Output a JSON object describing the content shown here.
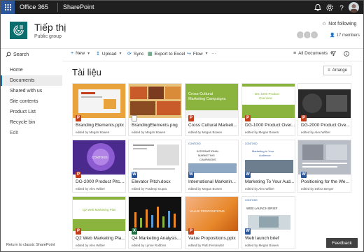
{
  "suite": {
    "brand": "Office 365",
    "app": "SharePoint",
    "icons": [
      "bell-icon",
      "gear-icon",
      "help-icon"
    ]
  },
  "site": {
    "title": "Tiếp thị",
    "subtitle": "Public group",
    "follow_label": "Not following",
    "members_label": "17 members"
  },
  "nav": {
    "search_label": "Search",
    "items": [
      {
        "label": "Home",
        "active": false
      },
      {
        "label": "Documents",
        "active": true
      },
      {
        "label": "Shared with us",
        "active": false
      },
      {
        "label": "Site contents",
        "active": false
      },
      {
        "label": "Product List",
        "active": false
      },
      {
        "label": "Recycle bin",
        "active": false
      },
      {
        "label": "Edit",
        "active": false
      }
    ],
    "return_label": "Return to classic SharePoint"
  },
  "commands": {
    "new": "New",
    "upload": "Upload",
    "sync": "Sync",
    "export": "Export to Excel",
    "flow": "Flow",
    "more": "···",
    "view": "All Documents"
  },
  "library": {
    "title": "Tài liệu",
    "arrange_label": "Arrange"
  },
  "tiles": [
    {
      "name": "Branding Elements.pptx",
      "edited": "edited by Megan Bowen",
      "type": "pptx",
      "thumb": "Brand",
      "colors": [
        "#e8a33c",
        "#ffffff"
      ]
    },
    {
      "name": "BrandingElements.png",
      "edited": "edited by Megan Bowen",
      "type": "png",
      "thumb": "",
      "colors": [
        "#c95b2a",
        "#e7c27a"
      ]
    },
    {
      "name": "Cross Cultural Marketi...",
      "edited": "edited by Megan Bowen",
      "type": "pptx",
      "thumb": "Cross-Cultural Marketing Campaigns",
      "colors": [
        "#8bb43e",
        "#ffffff"
      ]
    },
    {
      "name": "DG-1000 Product Over...",
      "edited": "edited by Megan Bowen",
      "type": "pptx",
      "thumb": "DG-1000 Product Overview",
      "colors": [
        "#ffffff",
        "#8bb43e"
      ]
    },
    {
      "name": "DG-2000 Product Ove...",
      "edited": "edited by Alex Wilber",
      "type": "pptx",
      "thumb": "",
      "colors": [
        "#2a2a2a",
        "#444444"
      ]
    },
    {
      "name": "DG-2000 Product Pitch...",
      "edited": "edited by Alex Wilber",
      "type": "pptx",
      "thumb": "CONTOSO",
      "colors": [
        "#4a2a8c",
        "#8c5ad1"
      ]
    },
    {
      "name": "Elevator Pitch.docx",
      "edited": "edited by Pradeep Gupta",
      "type": "docx",
      "thumb": "",
      "colors": [
        "#ffffff",
        "#dddddd"
      ]
    },
    {
      "name": "International Marketin...",
      "edited": "edited by Megan Bowen",
      "type": "docx",
      "thumb": "INTERNATIONAL MARKETING CAMPAIGNS",
      "colors": [
        "#ffffff",
        "#2b579a"
      ]
    },
    {
      "name": "Marketing To Your Aud...",
      "edited": "edited by Alex Wilber",
      "type": "docx",
      "thumb": "Marketing to Your Audience",
      "colors": [
        "#ffffff",
        "#2b579a"
      ]
    },
    {
      "name": "Positioning for the We...",
      "edited": "edited by Debra Berger",
      "type": "docx",
      "thumb": "",
      "colors": [
        "#b8bcc4",
        "#ffffff"
      ]
    },
    {
      "name": "Q2 Web Marketing Pla...",
      "edited": "edited by Alex Wilber",
      "type": "pptx",
      "thumb": "Q2 Web Marketing Plan",
      "colors": [
        "#ffffff",
        "#8bb43e"
      ]
    },
    {
      "name": "Q4 Marketing Analysis...",
      "edited": "edited by Lynne Robbins",
      "type": "xlsx",
      "thumb": "",
      "colors": [
        "#111111",
        "#333333"
      ]
    },
    {
      "name": "Value Propositions.pptx",
      "edited": "edited by Patti Fernandez",
      "type": "pptx",
      "thumb": "VALUE PROPOSITIONS",
      "colors": [
        "#e8892c",
        "#f4b183"
      ]
    },
    {
      "name": "Web launch brief",
      "edited": "edited by Megan Bowen",
      "type": "docx",
      "thumb": "WEB LAUNCH BRIEF",
      "colors": [
        "#ffffff",
        "#cfd8dc"
      ]
    }
  ],
  "feedback_label": "Feedback"
}
